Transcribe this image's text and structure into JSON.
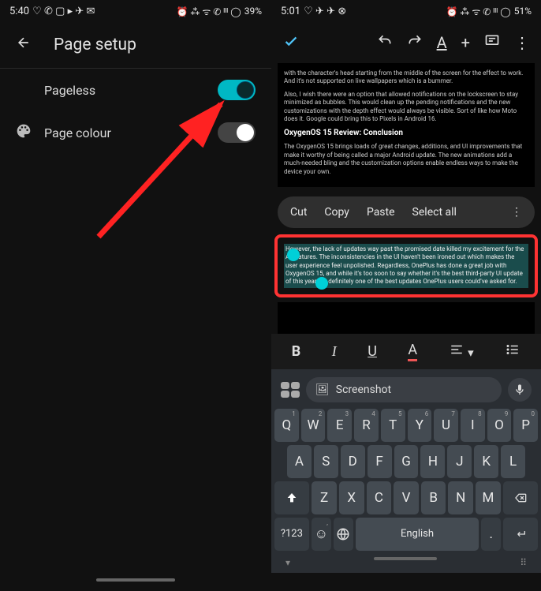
{
  "left": {
    "status": {
      "time": "5:40",
      "icons_left": "♡ ✆ ▢ ▸ ✈ ✉",
      "icons_right": "⏰ ⁂ ᯤ ✆ ᴵᴵᴵ ◯",
      "battery": "39%"
    },
    "header": {
      "title": "Page setup"
    },
    "rows": {
      "pageless": {
        "label": "Pageless",
        "on": true
      },
      "pagecolour": {
        "label": "Page colour",
        "on": false
      }
    }
  },
  "right": {
    "status": {
      "time": "5:01",
      "icons_left": "♡ ✈ ✈ ⊗",
      "icons_right": "⏰ ⁂ ᯤ ✆ ᴵᴵᴵ ◯",
      "battery": "51%"
    },
    "doc": {
      "p1": "with the character's head starting from the middle of the screen for the effect to work. And it's not supported on live wallpapers which is a bummer.",
      "p2": "Also, I wish there were an option that allowed notifications on the lockscreen to stay minimized as bubbles. This would clean up the pending notifications and the new customizations with the depth effect would always be visible. Sort of like how Moto does it. Google could bring this to Pixels in Android 16.",
      "h": "OxygenOS 15 Review: Conclusion",
      "p3": "The OxygenOS 15 brings loads of great changes, additions, and UI improvements that make it worthy of being called a major Android update. The new animations add a much-needed bling and the customization options enable endless ways to make the device your own.",
      "sel": "However, the lack of updates way past the promised date killed my excitement for the AI features. The inconsistencies in the UI haven't been ironed out which makes the user experience feel unpolished. Regardless, OnePlus has done a great job with OxygenOS 15, and while it's too soon to say whether it's the best third-party UI update of this year, it's definitely one of the best updates OnePlus users could've asked for."
    },
    "context": {
      "cut": "Cut",
      "copy": "Copy",
      "paste": "Paste",
      "selectall": "Select all"
    },
    "fmt": {
      "b": "B",
      "i": "I",
      "u": "U",
      "a": "A"
    },
    "sugg": {
      "text": "Screenshot"
    },
    "keys": {
      "r1": [
        "Q",
        "W",
        "E",
        "R",
        "T",
        "Y",
        "U",
        "I",
        "O",
        "P"
      ],
      "sup1": [
        "1",
        "2",
        "3",
        "4",
        "5",
        "6",
        "7",
        "8",
        "9",
        "0"
      ],
      "r2": [
        "A",
        "S",
        "D",
        "F",
        "G",
        "H",
        "J",
        "K",
        "L"
      ],
      "r3": [
        "Z",
        "X",
        "C",
        "V",
        "B",
        "N",
        "M"
      ],
      "num": "?123",
      "space": "English"
    }
  }
}
